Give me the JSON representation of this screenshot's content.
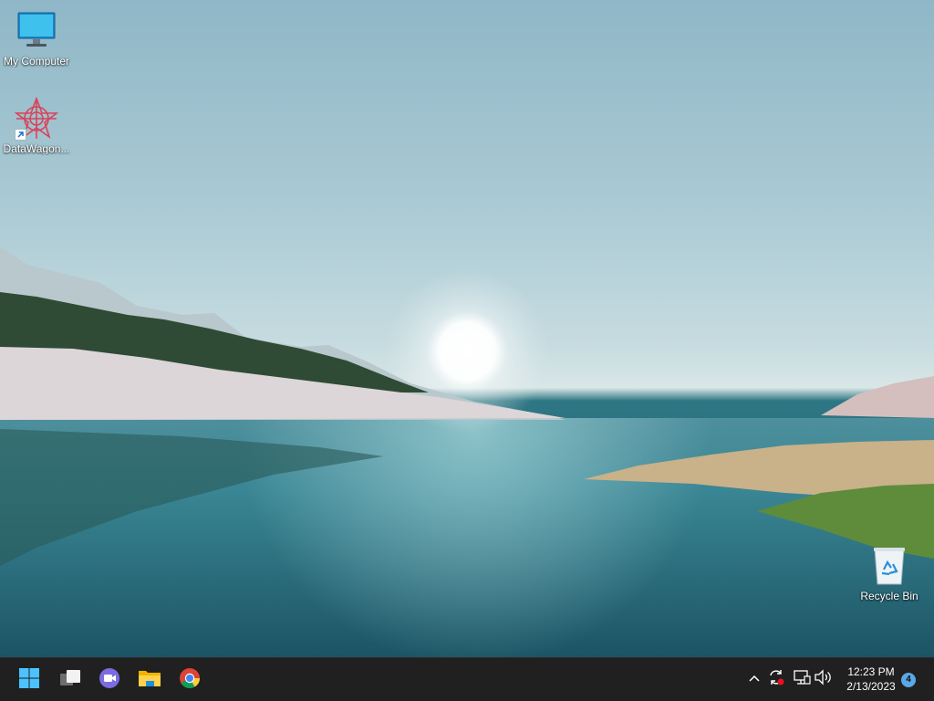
{
  "desktop": {
    "icons": [
      {
        "label": "My Computer",
        "icon": "computer-icon"
      },
      {
        "label": "DataWagon...",
        "icon": "datawagon-app-icon"
      },
      {
        "label": "Recycle Bin",
        "icon": "recycle-bin-icon"
      }
    ]
  },
  "taskbar": {
    "pinned": [
      {
        "icon": "windows-start-icon"
      },
      {
        "icon": "task-view-icon"
      },
      {
        "icon": "chat-icon"
      },
      {
        "icon": "file-explorer-icon"
      },
      {
        "icon": "chrome-icon"
      }
    ],
    "tray": {
      "icons": [
        "show-hidden-icons-chevron-icon",
        "sync-icon",
        "network-icon",
        "volume-icon"
      ],
      "time": "12:23 PM",
      "date": "2/13/2023",
      "notifications": "4"
    }
  },
  "colors": {
    "taskbar_bg": "#202020",
    "accent": "#5aa9e6"
  }
}
